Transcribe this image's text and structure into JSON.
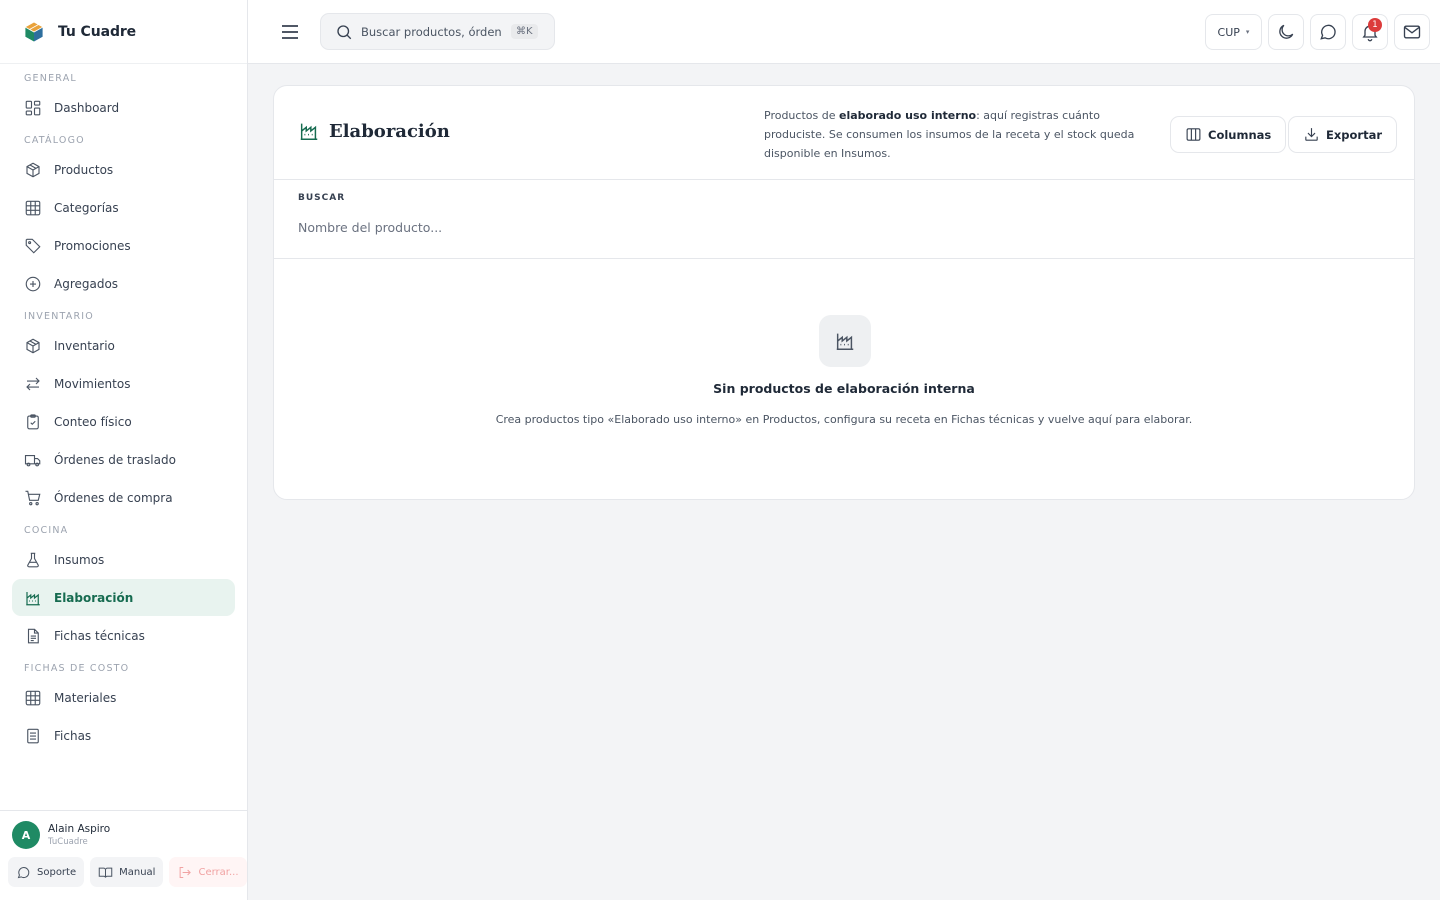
{
  "brand": {
    "name": "Tu Cuadre",
    "logo_icon": "cube-logo-icon",
    "accent": "#1f8a64"
  },
  "sidebar": {
    "sections": [
      {
        "title": "GENERAL",
        "items": [
          {
            "label": "Dashboard",
            "icon": "dashboard-icon"
          }
        ]
      },
      {
        "title": "CATÁLOGO",
        "items": [
          {
            "label": "Productos",
            "icon": "box-icon"
          },
          {
            "label": "Categorías",
            "icon": "grid-icon"
          },
          {
            "label": "Promociones",
            "icon": "tag-icon"
          },
          {
            "label": "Agregados",
            "icon": "plus-circle-icon"
          }
        ]
      },
      {
        "title": "INVENTARIO",
        "items": [
          {
            "label": "Inventario",
            "icon": "box-icon"
          },
          {
            "label": "Movimientos",
            "icon": "arrows-icon"
          },
          {
            "label": "Conteo físico",
            "icon": "clipboard-check-icon"
          },
          {
            "label": "Órdenes de traslado",
            "icon": "truck-icon"
          },
          {
            "label": "Órdenes de compra",
            "icon": "cart-icon"
          }
        ]
      },
      {
        "title": "COCINA",
        "items": [
          {
            "label": "Insumos",
            "icon": "flask-icon"
          },
          {
            "label": "Elaboración",
            "icon": "factory-icon",
            "active": true
          },
          {
            "label": "Fichas técnicas",
            "icon": "document-icon"
          }
        ]
      },
      {
        "title": "FICHAS DE COSTO",
        "items": [
          {
            "label": "Materiales",
            "icon": "grid-icon"
          },
          {
            "label": "Fichas",
            "icon": "list-icon"
          }
        ]
      }
    ]
  },
  "user": {
    "initial": "A",
    "name": "Alain Aspiro",
    "org": "TuCuadre",
    "actions": {
      "support": "Soporte",
      "manual": "Manual",
      "logout": "Cerrar..."
    }
  },
  "topbar": {
    "search_placeholder": "Buscar productos, órdenes",
    "shortcut": "⌘K",
    "currency": "CUP",
    "notifications_count": "1"
  },
  "page": {
    "title": "Elaboración",
    "desc_prefix": "Productos de ",
    "desc_bold": "elaborado uso interno",
    "desc_suffix": ": aquí registras cuánto produciste. Se consumen los insumos de la receta y el stock queda disponible en Insumos.",
    "columns_label": "Columnas",
    "export_label": "Exportar",
    "filter_label": "BUSCAR",
    "filter_placeholder": "Nombre del producto...",
    "empty_title": "Sin productos de elaboración interna",
    "empty_desc": "Crea productos tipo «Elaborado uso interno» en Productos, configura su receta en Fichas técnicas y vuelve aquí para elaborar."
  }
}
